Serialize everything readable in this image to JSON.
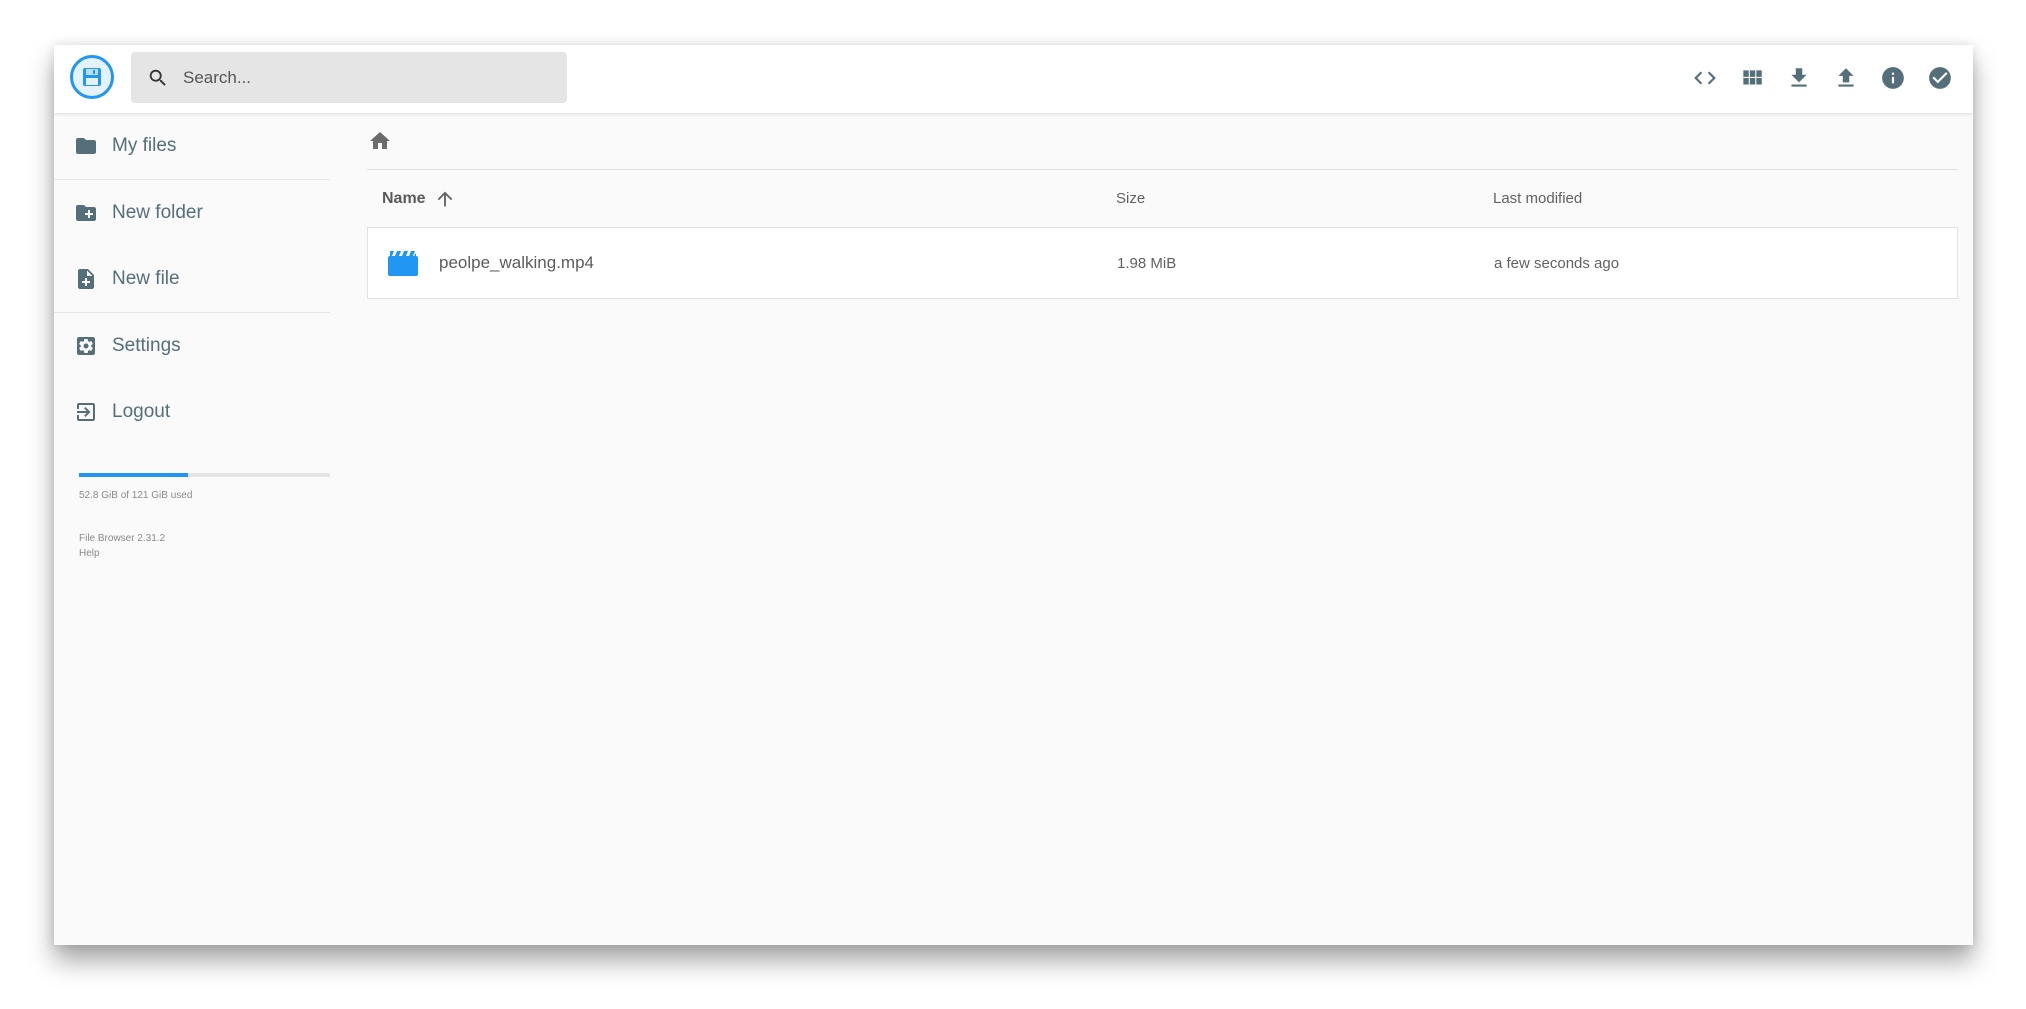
{
  "header": {
    "search_placeholder": "Search...",
    "actions": [
      {
        "name": "code-icon",
        "label": "Toggle code view"
      },
      {
        "name": "grid-view-icon",
        "label": "Switch view"
      },
      {
        "name": "download-icon",
        "label": "Download"
      },
      {
        "name": "upload-icon",
        "label": "Upload"
      },
      {
        "name": "info-icon",
        "label": "Info"
      },
      {
        "name": "check-circle-icon",
        "label": "Select multiple"
      }
    ]
  },
  "sidebar": {
    "items": [
      {
        "label": "My files",
        "icon": "folder-icon"
      },
      {
        "label": "New folder",
        "icon": "create-new-folder-icon"
      },
      {
        "label": "New file",
        "icon": "note-add-icon"
      },
      {
        "label": "Settings",
        "icon": "settings-icon"
      },
      {
        "label": "Logout",
        "icon": "exit-icon"
      }
    ],
    "quota": {
      "text": "52.8 GiB of 121 GiB used",
      "used_fraction": 0.436
    },
    "credits": {
      "version": "File Browser 2.31.2",
      "help": "Help"
    }
  },
  "main": {
    "columns": {
      "name": "Name",
      "size": "Size",
      "modified": "Last modified"
    },
    "files": [
      {
        "name": "peolpe_walking.mp4",
        "size": "1.98 MiB",
        "modified": "a few seconds ago",
        "icon": "movie-icon"
      }
    ]
  },
  "colors": {
    "accent": "#2196f3",
    "icon_gray": "#546e7a"
  }
}
